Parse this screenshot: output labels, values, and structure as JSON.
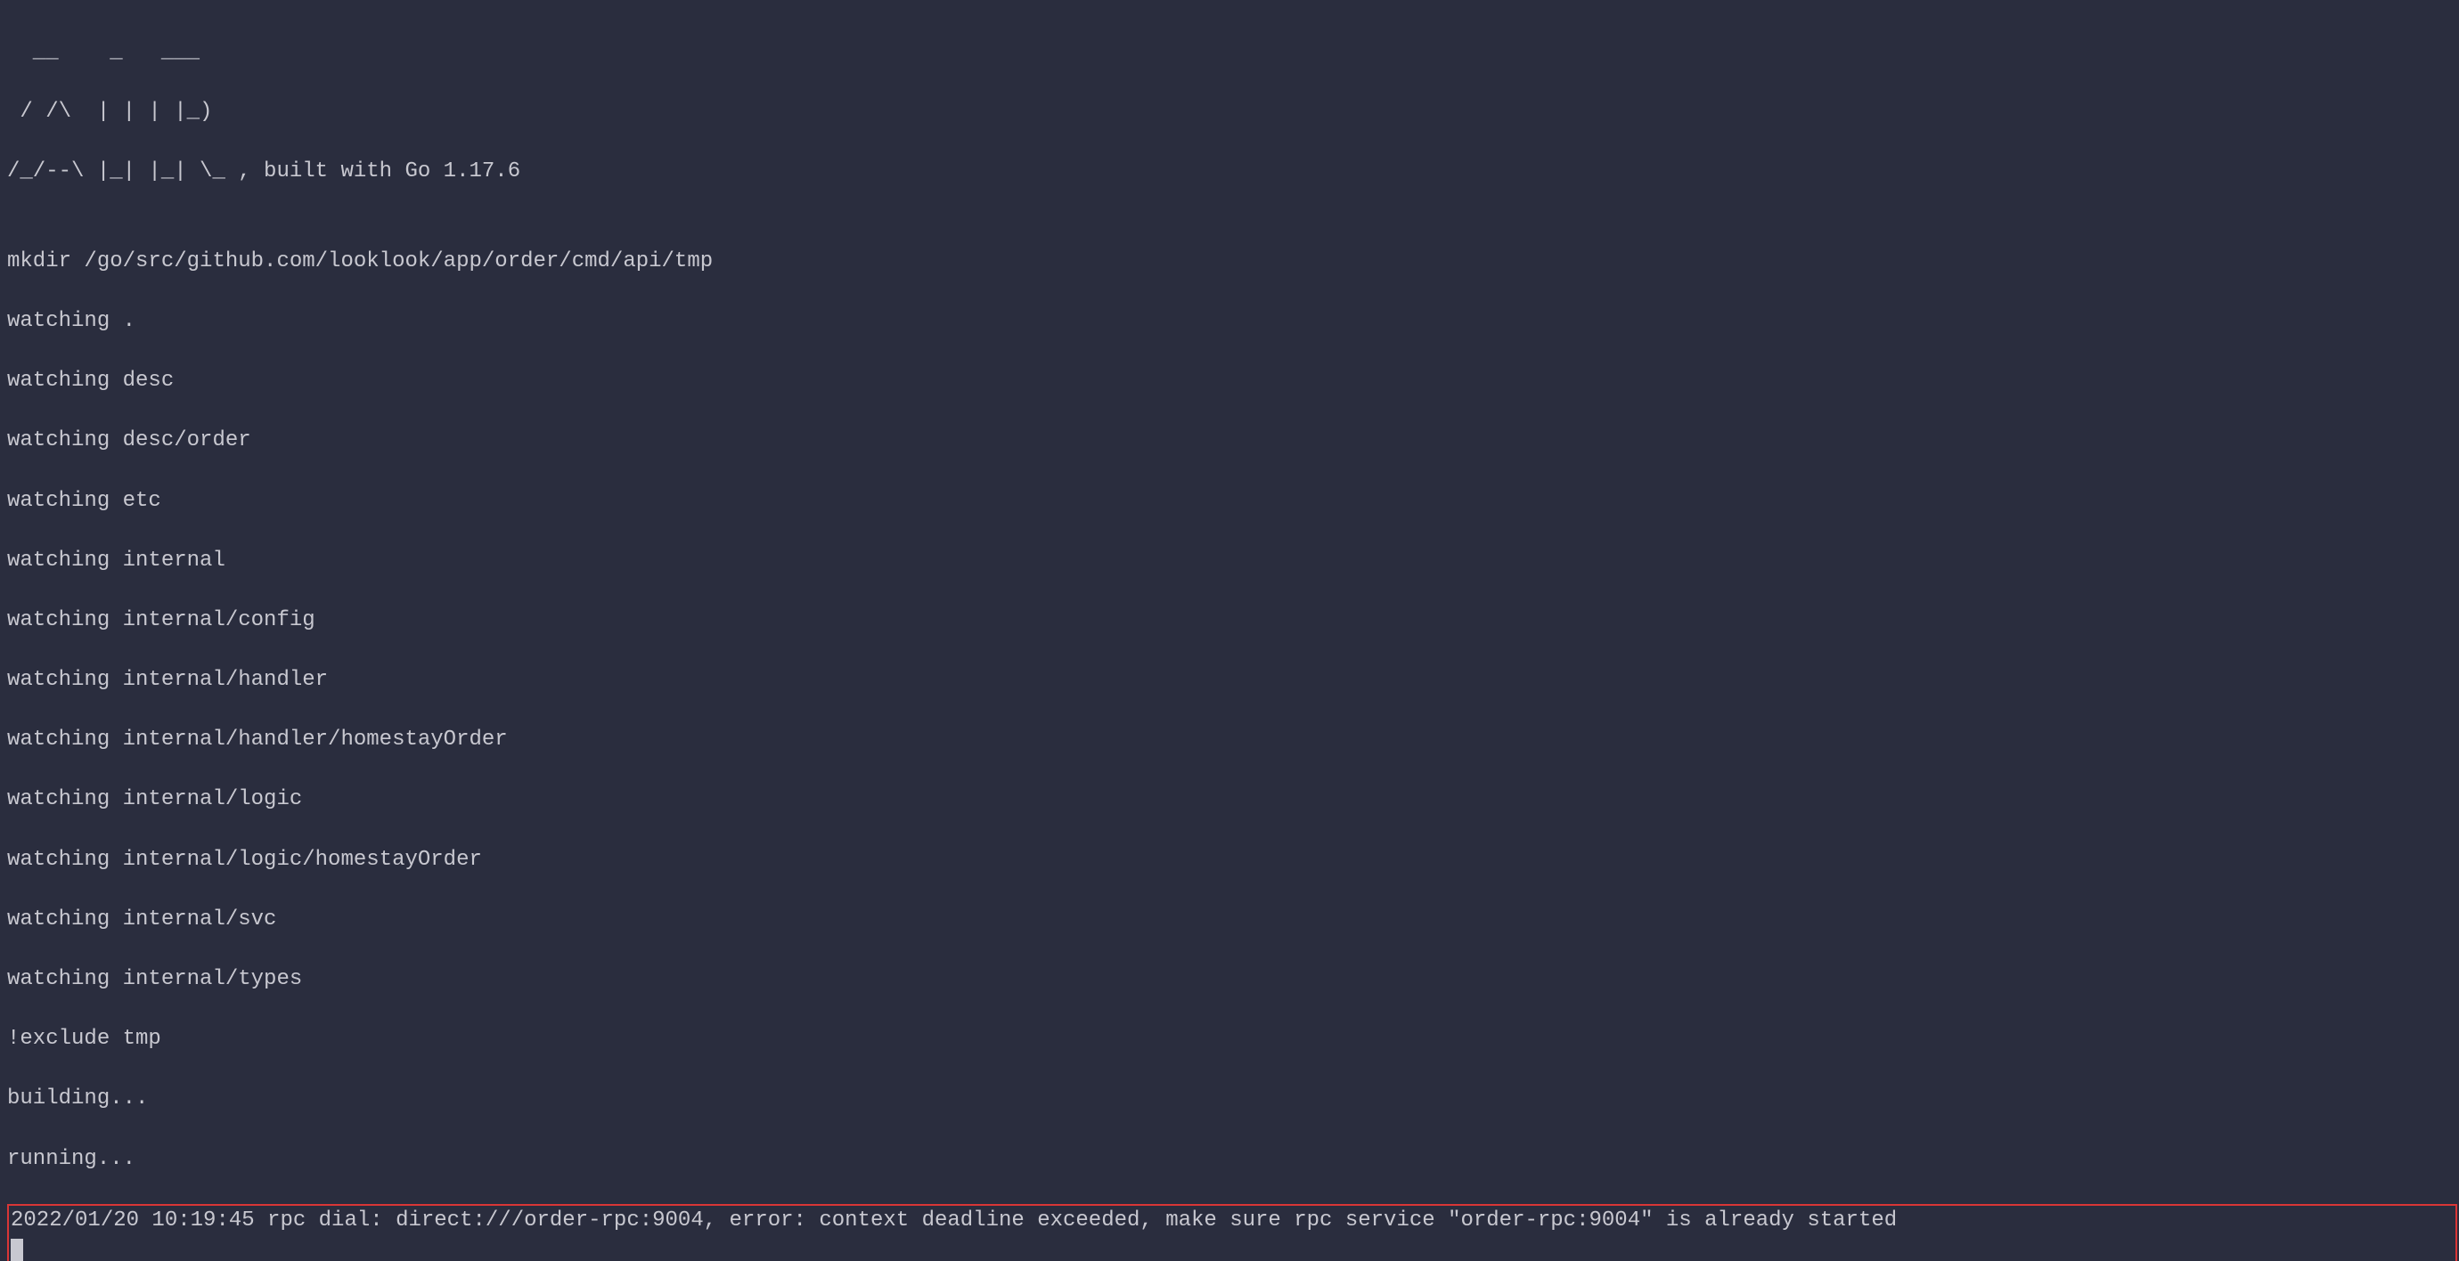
{
  "ascii_art": {
    "line1": "  __    _   ___  ",
    "line2": " / /\\  | | | |_) ",
    "line3": "/_/--\\ |_| |_| \\_ , built with Go 1.17.6"
  },
  "output": {
    "blank1": "",
    "mkdir": "mkdir /go/src/github.com/looklook/app/order/cmd/api/tmp",
    "watching": [
      "watching .",
      "watching desc",
      "watching desc/order",
      "watching etc",
      "watching internal",
      "watching internal/config",
      "watching internal/handler",
      "watching internal/handler/homestayOrder",
      "watching internal/logic",
      "watching internal/logic/homestayOrder",
      "watching internal/svc",
      "watching internal/types"
    ],
    "exclude": "!exclude tmp",
    "building": "building...",
    "running": "running...",
    "error": "2022/01/20 10:19:45 rpc dial: direct:///order-rpc:9004, error: context deadline exceeded, make sure rpc service \"order-rpc:9004\" is already started"
  }
}
